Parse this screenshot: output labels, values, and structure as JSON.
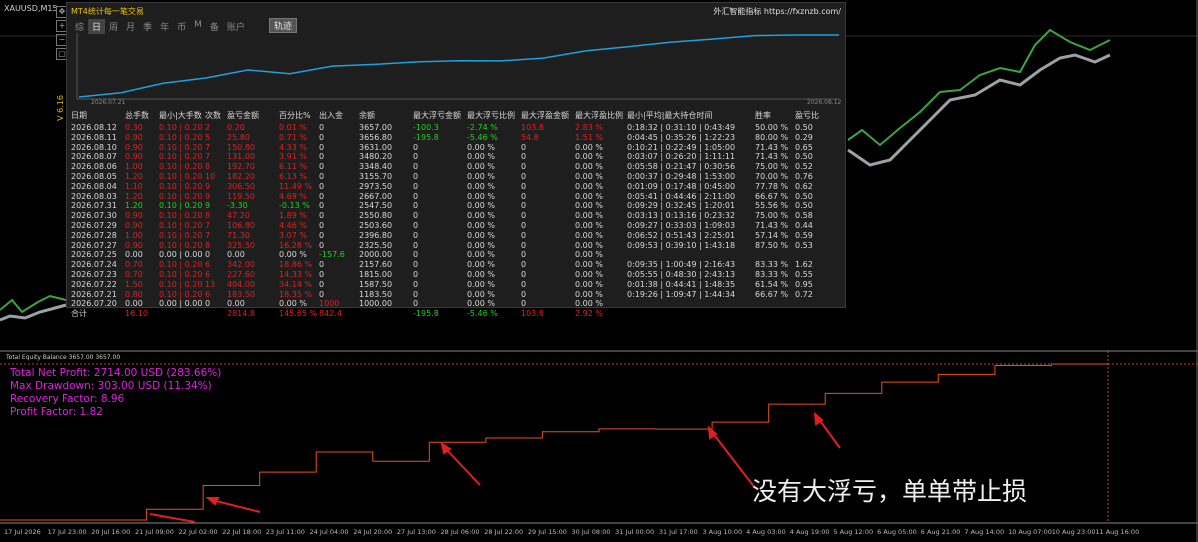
{
  "symbol_label": "XAUUSD,M15",
  "side_label": "V 6.16",
  "panel": {
    "title": "MT4统计每一笔交易",
    "website_name": "外汇智能指标",
    "website_url": "https://fxznzb.com/",
    "tabs": [
      "综",
      "日",
      "周",
      "月",
      "季",
      "年",
      "币",
      "M",
      "备",
      "账户"
    ],
    "active_tab": 1,
    "track_button": "轨迹",
    "chart_start_date": "2026.07.21",
    "chart_end_date": "2026.08.12",
    "headers": [
      "日期",
      "总手数",
      "最小|大手数",
      "次数",
      "盈亏金额",
      "百分比%",
      "出入金",
      "余额",
      "最大浮亏金额",
      "最大浮亏比例",
      "最大浮盈金额",
      "最大浮盈比例",
      "最小|平均|最大持仓时间",
      "胜率",
      "盈亏比"
    ],
    "rows": [
      {
        "date": "2026.08.12",
        "lots": "0.30",
        "minmax": "0.10 | 0.20",
        "count": "2",
        "pnl": "0.20",
        "pct": "0.01 %",
        "io": "0",
        "bal": "3657.00",
        "mfl": "-100.3",
        "mflp": "-2.74 %",
        "mfp": "103.8",
        "mfpp": "2.83 %",
        "time": "0:18:32 | 0:31:10 | 0:43:49",
        "win": "50.00 %",
        "pr": "0.50",
        "c": "red"
      },
      {
        "date": "2026.08.11",
        "lots": "0.90",
        "minmax": "0.10 | 0.20",
        "count": "5",
        "pnl": "25.80",
        "pct": "0.71 %",
        "io": "0",
        "bal": "3656.80",
        "mfl": "-195.8",
        "mflp": "-5.46 %",
        "mfp": "54.8",
        "mfpp": "1.51 %",
        "time": "0:04:45 | 0:35:26 | 1:22:23",
        "win": "80.00 %",
        "pr": "0.29",
        "c": "red"
      },
      {
        "date": "2026.08.10",
        "lots": "0.90",
        "minmax": "0.10 | 0.20",
        "count": "7",
        "pnl": "150.80",
        "pct": "4.33 %",
        "io": "0",
        "bal": "3631.00",
        "mfl": "0",
        "mflp": "0.00 %",
        "mfp": "0",
        "mfpp": "0.00 %",
        "time": "0:10:21 | 0:22:49 | 1:05:00",
        "win": "71.43 %",
        "pr": "0.65",
        "c": "red"
      },
      {
        "date": "2026.08.07",
        "lots": "0.90",
        "minmax": "0.10 | 0.20",
        "count": "7",
        "pnl": "131.00",
        "pct": "3.91 %",
        "io": "0",
        "bal": "3480.20",
        "mfl": "0",
        "mflp": "0.00 %",
        "mfp": "0",
        "mfpp": "0.00 %",
        "time": "0:03:07 | 0:26:20 | 1:11:11",
        "win": "71.43 %",
        "pr": "0.50",
        "c": "red"
      },
      {
        "date": "2026.08.06",
        "lots": "1.00",
        "minmax": "0.10 | 0.20",
        "count": "8",
        "pnl": "192.70",
        "pct": "6.11 %",
        "io": "0",
        "bal": "3348.40",
        "mfl": "0",
        "mflp": "0.00 %",
        "mfp": "0",
        "mfpp": "0.00 %",
        "time": "0:05:58 | 0:21:47 | 0:30:56",
        "win": "75.00 %",
        "pr": "0.52",
        "c": "red"
      },
      {
        "date": "2026.08.05",
        "lots": "1.20",
        "minmax": "0.10 | 0.20",
        "count": "10",
        "pnl": "182.20",
        "pct": "6.13 %",
        "io": "0",
        "bal": "3155.70",
        "mfl": "0",
        "mflp": "0.00 %",
        "mfp": "0",
        "mfpp": "0.00 %",
        "time": "0:00:37 | 0:29:48 | 1:53:00",
        "win": "70.00 %",
        "pr": "0.76",
        "c": "red"
      },
      {
        "date": "2026.08.04",
        "lots": "1.10",
        "minmax": "0.10 | 0.20",
        "count": "9",
        "pnl": "306.50",
        "pct": "11.49 %",
        "io": "0",
        "bal": "2973.50",
        "mfl": "0",
        "mflp": "0.00 %",
        "mfp": "0",
        "mfpp": "0.00 %",
        "time": "0:01:09 | 0:17:48 | 0:45:00",
        "win": "77.78 %",
        "pr": "0.62",
        "c": "red"
      },
      {
        "date": "2026.08.03",
        "lots": "1.20",
        "minmax": "0.10 | 0.20",
        "count": "9",
        "pnl": "119.50",
        "pct": "4.69 %",
        "io": "0",
        "bal": "2667.00",
        "mfl": "0",
        "mflp": "0.00 %",
        "mfp": "0",
        "mfpp": "0.00 %",
        "time": "0:05:41 | 0:44:46 | 2:11:00",
        "win": "66.67 %",
        "pr": "0.50",
        "c": "red"
      },
      {
        "date": "2026.07.31",
        "lots": "1.20",
        "minmax": "0.10 | 0.20",
        "count": "9",
        "pnl": "-3.30",
        "pct": "-0.13 %",
        "io": "0",
        "bal": "2547.50",
        "mfl": "0",
        "mflp": "0.00 %",
        "mfp": "0",
        "mfpp": "0.00 %",
        "time": "0:09:29 | 0:32:45 | 1:20:01",
        "win": "55.56 %",
        "pr": "0.50",
        "c": "green"
      },
      {
        "date": "2026.07.30",
        "lots": "0.90",
        "minmax": "0.10 | 0.20",
        "count": "8",
        "pnl": "47.20",
        "pct": "1.89 %",
        "io": "0",
        "bal": "2550.80",
        "mfl": "0",
        "mflp": "0.00 %",
        "mfp": "0",
        "mfpp": "0.00 %",
        "time": "0:03:13 | 0:13:16 | 0:23:32",
        "win": "75.00 %",
        "pr": "0.58",
        "c": "red"
      },
      {
        "date": "2026.07.29",
        "lots": "0.90",
        "minmax": "0.10 | 0.20",
        "count": "7",
        "pnl": "106.80",
        "pct": "4.46 %",
        "io": "0",
        "bal": "2503.60",
        "mfl": "0",
        "mflp": "0.00 %",
        "mfp": "0",
        "mfpp": "0.00 %",
        "time": "0:09:27 | 0:33:03 | 1:09:03",
        "win": "71.43 %",
        "pr": "0.44",
        "c": "red"
      },
      {
        "date": "2026.07.28",
        "lots": "1.00",
        "minmax": "0.10 | 0.20",
        "count": "7",
        "pnl": "71.30",
        "pct": "3.07 %",
        "io": "0",
        "bal": "2396.80",
        "mfl": "0",
        "mflp": "0.00 %",
        "mfp": "0",
        "mfpp": "0.00 %",
        "time": "0:06:52 | 0:51:43 | 2:25:01",
        "win": "57.14 %",
        "pr": "0.59",
        "c": "red"
      },
      {
        "date": "2026.07.27",
        "lots": "0.90",
        "minmax": "0.10 | 0.20",
        "count": "8",
        "pnl": "325.50",
        "pct": "16.28 %",
        "io": "0",
        "bal": "2325.50",
        "mfl": "0",
        "mflp": "0.00 %",
        "mfp": "0",
        "mfpp": "0.00 %",
        "time": "0:09:53 | 0:39:10 | 1:43:18",
        "win": "87.50 %",
        "pr": "0.53",
        "c": "red"
      },
      {
        "date": "2026.07.25",
        "lots": "0.00",
        "minmax": "0.00 | 0.00",
        "count": "0",
        "pnl": "0.00",
        "pct": "0.00 %",
        "io": "-157.6",
        "bal": "2000.00",
        "mfl": "0",
        "mflp": "0.00 %",
        "mfp": "0",
        "mfpp": "0.00 %",
        "time": "",
        "win": "",
        "pr": "",
        "c": "white",
        "ioc": "green"
      },
      {
        "date": "2026.07.24",
        "lots": "0.70",
        "minmax": "0.10 | 0.20",
        "count": "6",
        "pnl": "342.00",
        "pct": "18.86 %",
        "io": "0",
        "bal": "2157.60",
        "mfl": "0",
        "mflp": "0.00 %",
        "mfp": "0",
        "mfpp": "0.00 %",
        "time": "0:09:35 | 1:00:49 | 2:16:43",
        "win": "83.33 %",
        "pr": "1.62",
        "c": "red"
      },
      {
        "date": "2026.07.23",
        "lots": "0.70",
        "minmax": "0.10 | 0.20",
        "count": "6",
        "pnl": "227.60",
        "pct": "14.33 %",
        "io": "0",
        "bal": "1815.00",
        "mfl": "0",
        "mflp": "0.00 %",
        "mfp": "0",
        "mfpp": "0.00 %",
        "time": "0:05:55 | 0:48:30 | 2:43:13",
        "win": "83.33 %",
        "pr": "0.55",
        "c": "red"
      },
      {
        "date": "2026.07.22",
        "lots": "1.50",
        "minmax": "0.10 | 0.20",
        "count": "13",
        "pnl": "404.00",
        "pct": "34.14 %",
        "io": "0",
        "bal": "1587.50",
        "mfl": "0",
        "mflp": "0.00 %",
        "mfp": "0",
        "mfpp": "0.00 %",
        "time": "0:01:38 | 0:44:41 | 1:48:35",
        "win": "61.54 %",
        "pr": "0.95",
        "c": "red"
      },
      {
        "date": "2026.07.21",
        "lots": "0.80",
        "minmax": "0.10 | 0.20",
        "count": "6",
        "pnl": "183.50",
        "pct": "18.35 %",
        "io": "0",
        "bal": "1183.50",
        "mfl": "0",
        "mflp": "0.00 %",
        "mfp": "0",
        "mfpp": "0.00 %",
        "time": "0:19:26 | 1:09:47 | 1:44:34",
        "win": "66.67 %",
        "pr": "0.72",
        "c": "red"
      },
      {
        "date": "2026.07.20",
        "lots": "0.00",
        "minmax": "0.00 | 0.00",
        "count": "0",
        "pnl": "0.00",
        "pct": "0.00 %",
        "io": "1000",
        "bal": "1000.00",
        "mfl": "0",
        "mflp": "0.00 %",
        "mfp": "0",
        "mfpp": "0.00 %",
        "time": "",
        "win": "",
        "pr": "",
        "c": "white",
        "ioc": "red"
      }
    ],
    "total": {
      "date": "合计",
      "lots": "16.10",
      "pnl": "2814.8",
      "pct": "145.65 %",
      "io": "842.4",
      "mfl": "-195.8",
      "mflp": "-5.46 %",
      "mfp": "103.8",
      "mfpp": "2.92 %"
    }
  },
  "equity_label": "Total Equity Balance 3657.00 3657.00",
  "stats": {
    "net_profit": "Total Net Profit: 2714.00 USD (283.66%)",
    "max_drawdown": "Max Drawdown: 303.00 USD (11.34%)",
    "recovery_factor": "Recovery Factor: 8.96",
    "profit_factor": "Profit Factor: 1.82"
  },
  "annotation": "没有大浮亏，单单带止损",
  "x_axis_labels": [
    "17 Jul 2026",
    "17 Jul 23:00",
    "20 Jul 16:00",
    "21 Jul 09:00",
    "22 Jul 02:00",
    "22 Jul 18:00",
    "23 Jul 11:00",
    "24 Jul 04:00",
    "24 Jul 20:00",
    "27 Jul 13:00",
    "28 Jul 06:00",
    "28 Jul 22:00",
    "29 Jul 15:00",
    "30 Jul 08:00",
    "31 Jul 00:00",
    "31 Jul 17:00",
    "3 Aug 10:00",
    "4 Aug 03:00",
    "4 Aug 19:00",
    "5 Aug 12:00",
    "6 Aug 05:00",
    "6 Aug 21:00",
    "7 Aug 14:00",
    "10 Aug 07:00",
    "10 Aug 23:00",
    "11 Aug 16:00"
  ],
  "colors": {
    "equity_line": "#e8501e",
    "balance_dd": "#4aa6e6",
    "stats": "#e020e0",
    "grid": "#ff5a2a"
  }
}
